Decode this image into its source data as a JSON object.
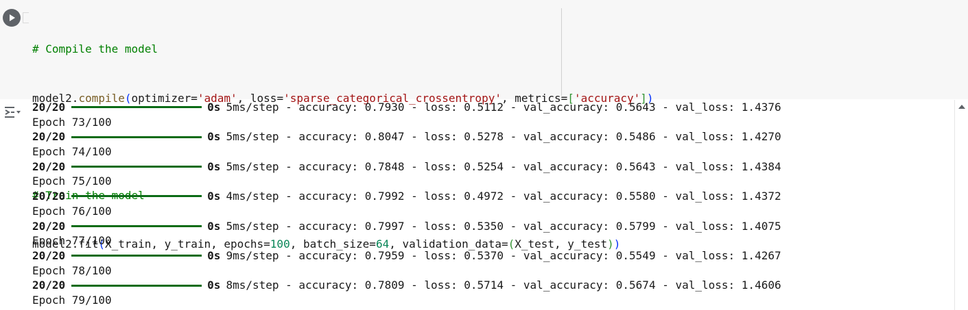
{
  "code": {
    "line1_comment": "# Compile the model",
    "line2": {
      "obj": "model2.",
      "func": "compile",
      "open": "(",
      "arg1": "optimizer=",
      "s1": "'adam'",
      "arg2": ", loss=",
      "s2": "'sparse_categorical_crossentropy'",
      "arg3": ", metrics=",
      "bopen": "[",
      "s3": "'accuracy'",
      "bclose": "]",
      "close": ")"
    },
    "line4_comment": "# Train the model",
    "line5": {
      "obj": "model2.fit",
      "open": "(",
      "a1": "X_train, y_train, epochs=",
      "n1": "100",
      "a2": ", batch_size=",
      "n2": "64",
      "a3": ", validation_data=",
      "inner_open": "(",
      "a4": "X_test, y_test",
      "inner_close": ")",
      "close": ")"
    }
  },
  "output": {
    "lines": [
      {
        "kind": "step",
        "step": "20/20",
        "zero": "0s",
        "rest": "5ms/step - accuracy: 0.7930 - loss: 0.5112 - val_accuracy: 0.5643 - val_loss: 1.4376"
      },
      {
        "kind": "epoch",
        "text": "Epoch 73/100"
      },
      {
        "kind": "step",
        "step": "20/20",
        "zero": "0s",
        "rest": "5ms/step - accuracy: 0.8047 - loss: 0.5278 - val_accuracy: 0.5486 - val_loss: 1.4270"
      },
      {
        "kind": "epoch",
        "text": "Epoch 74/100"
      },
      {
        "kind": "step",
        "step": "20/20",
        "zero": "0s",
        "rest": "5ms/step - accuracy: 0.7848 - loss: 0.5254 - val_accuracy: 0.5643 - val_loss: 1.4384"
      },
      {
        "kind": "epoch",
        "text": "Epoch 75/100"
      },
      {
        "kind": "step",
        "step": "20/20",
        "zero": "0s",
        "rest": "4ms/step - accuracy: 0.7992 - loss: 0.4972 - val_accuracy: 0.5580 - val_loss: 1.4372"
      },
      {
        "kind": "epoch",
        "text": "Epoch 76/100"
      },
      {
        "kind": "step",
        "step": "20/20",
        "zero": "0s",
        "rest": "5ms/step - accuracy: 0.7997 - loss: 0.5350 - val_accuracy: 0.5799 - val_loss: 1.4075"
      },
      {
        "kind": "epoch",
        "text": "Epoch 77/100"
      },
      {
        "kind": "step",
        "step": "20/20",
        "zero": "0s",
        "rest": "9ms/step - accuracy: 0.7959 - loss: 0.5370 - val_accuracy: 0.5549 - val_loss: 1.4267"
      },
      {
        "kind": "epoch",
        "text": "Epoch 78/100"
      },
      {
        "kind": "step",
        "step": "20/20",
        "zero": "0s",
        "rest": "8ms/step - accuracy: 0.7809 - loss: 0.5714 - val_accuracy: 0.5674 - val_loss: 1.4606"
      },
      {
        "kind": "epoch",
        "text": "Epoch 79/100"
      }
    ]
  },
  "icons": {
    "run": "play-icon",
    "output_toggle": "output-toggle-icon",
    "scroll_up": "scroll-up-arrow-icon"
  },
  "colors": {
    "progress_bar": "#0b6b16",
    "comment": "#008000",
    "string": "#a31515",
    "number": "#098658"
  }
}
